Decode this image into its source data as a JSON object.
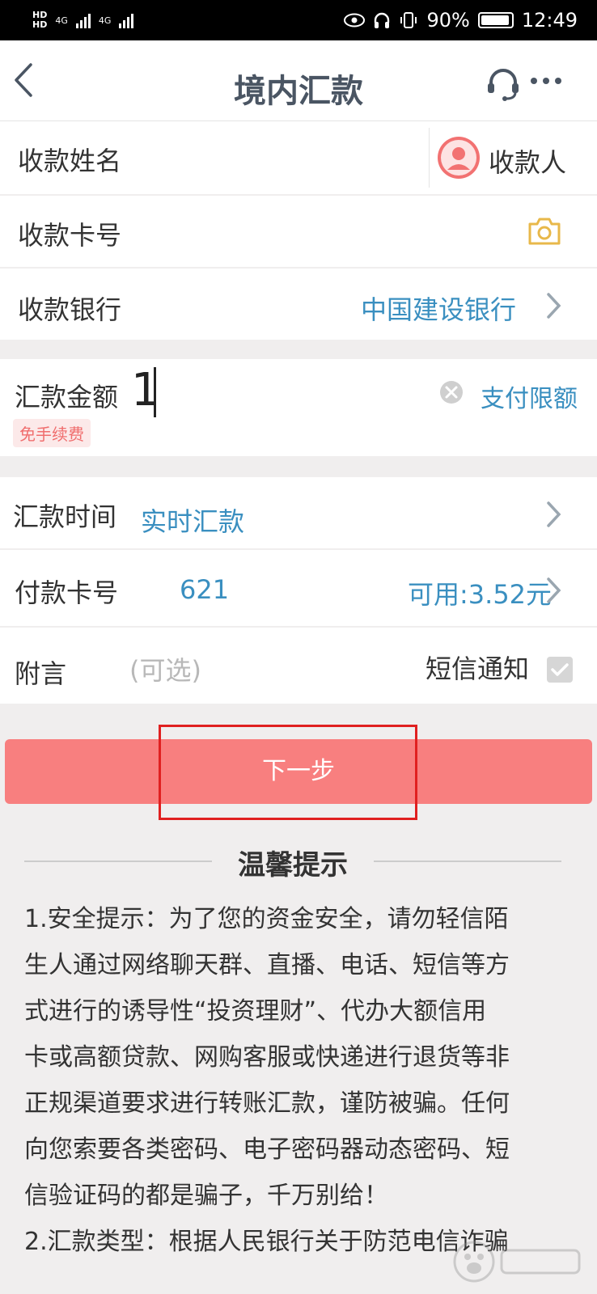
{
  "status_bar": {
    "network_left": "HD",
    "network_right": "4G",
    "battery_pct": "90%",
    "time": "12:49"
  },
  "header": {
    "title": "境内汇款"
  },
  "form": {
    "payee_name": {
      "label": "收款姓名",
      "value": "",
      "contact_label": "收款人"
    },
    "payee_card": {
      "label": "收款卡号",
      "value": ""
    },
    "payee_bank": {
      "label": "收款银行",
      "value": "中国建设银行"
    },
    "amount": {
      "label": "汇款金额",
      "value": "1",
      "fee_badge": "免手续费",
      "limit_link": "支付限额"
    },
    "time": {
      "label": "汇款时间",
      "value": "实时汇款"
    },
    "pay_card": {
      "label": "付款卡号",
      "value": "621",
      "available": "可用:3.52元"
    },
    "memo": {
      "label": "附言",
      "placeholder": "(可选)",
      "sms_label": "短信通知",
      "sms_checked": true
    }
  },
  "next_button": {
    "label": "下一步"
  },
  "tips": {
    "title": "温馨提示",
    "lines": [
      "1.安全提示：为了您的资金安全，请勿轻信陌",
      "生人通过网络聊天群、直播、电话、短信等方",
      "式进行的诱导性“投资理财”、代办大额信用",
      "卡或高额贷款、网购客服或快递进行退货等非",
      "正规渠道要求进行转账汇款，谨防被骗。任何",
      "向您索要各类密码、电子密码器动态密码、短",
      "信验证码的都是骗子，千万别给！",
      "2.汇款类型：根据人民银行关于防范电信诈骗"
    ]
  },
  "colors": {
    "accent_blue": "#3a8fc0",
    "button_red": "#f87f7f",
    "highlight_box": "#e02020",
    "fee_badge": "#f06e6e"
  },
  "icons": {
    "back": "chevron-left-icon",
    "service": "headset-icon",
    "more": "more-dots-icon",
    "contact": "user-avatar-icon",
    "camera": "camera-icon",
    "clear": "clear-circle-icon",
    "chevron": "chevron-right-icon",
    "checkbox": "check-icon"
  }
}
